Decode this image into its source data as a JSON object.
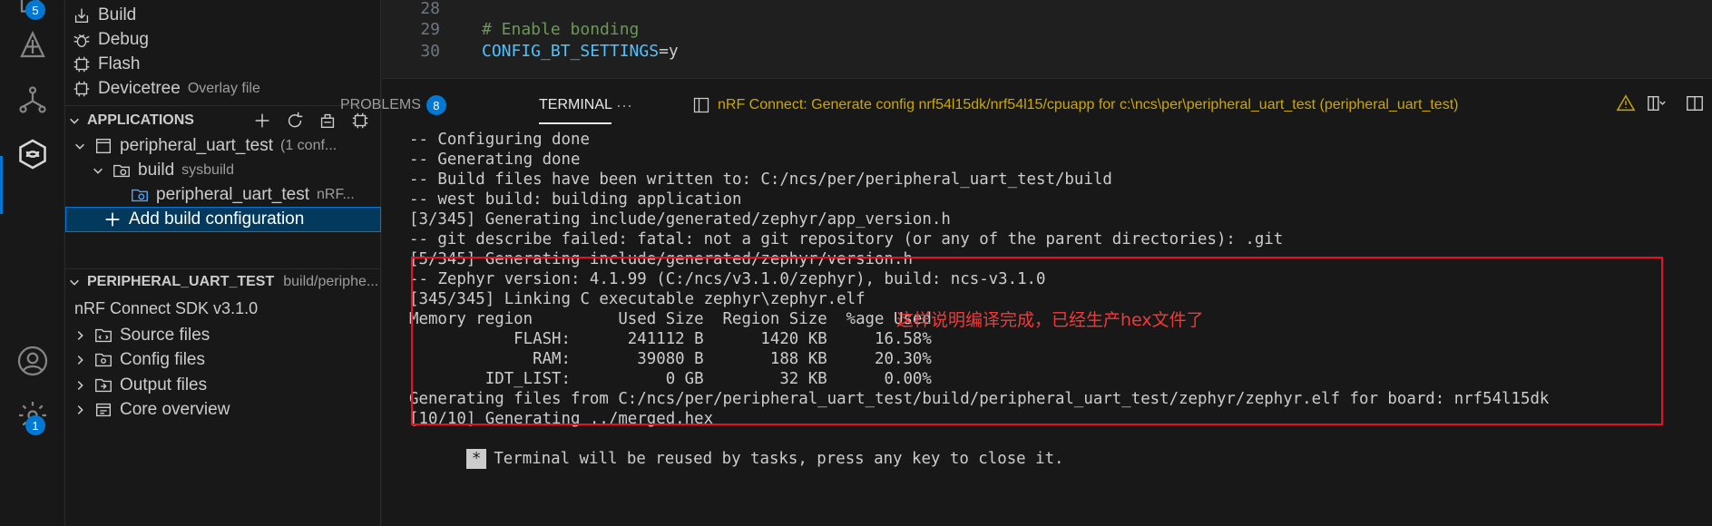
{
  "activity_bar": {
    "explorer_badge": "5",
    "settings_badge": "1"
  },
  "sidebar": {
    "actions": [
      {
        "label": "Build",
        "icon": "build-icon"
      },
      {
        "label": "Debug",
        "icon": "debug-icon"
      },
      {
        "label": "Flash",
        "icon": "flash-icon"
      },
      {
        "label": "Devicetree",
        "desc": "Overlay file",
        "icon": "devicetree-icon"
      }
    ],
    "applications_header": "APPLICATIONS",
    "app": {
      "label": "peripheral_uart_test",
      "desc": "(1 conf..."
    },
    "build": {
      "label": "build",
      "desc": "sysbuild"
    },
    "build_image": {
      "label": "peripheral_uart_test",
      "desc": "nRF..."
    },
    "add_build_configuration": "Add build configuration",
    "details_header": "PERIPHERAL_UART_TEST",
    "details_desc": "build/periphe...",
    "sdk_version": "nRF Connect SDK v3.1.0",
    "details_items": [
      {
        "label": "Source files",
        "icon": "source-files-icon"
      },
      {
        "label": "Config files",
        "icon": "config-files-icon"
      },
      {
        "label": "Output files",
        "icon": "output-files-icon"
      },
      {
        "label": "Core overview",
        "icon": "core-overview-icon"
      }
    ]
  },
  "editor": {
    "lines": [
      {
        "number": "28",
        "text": ""
      },
      {
        "number": "29",
        "comment": "# Enable bonding"
      },
      {
        "number": "30",
        "key": "CONFIG_BT_SETTINGS",
        "value": "=y"
      }
    ]
  },
  "panel": {
    "tabs": [
      {
        "label": "PROBLEMS",
        "badge": "8"
      },
      {
        "label": "TERMINAL"
      }
    ],
    "more": "···",
    "task_title": "nRF Connect: Generate config nrf54l15dk/nrf54l15/cpuapp for c:\\ncs\\per\\peripheral_uart_test (peripheral_uart_test)",
    "terminal_lines": [
      "-- Configuring done",
      "-- Generating done",
      "-- Build files have been written to: C:/ncs/per/peripheral_uart_test/build",
      "-- west build: building application",
      "[3/345] Generating include/generated/zephyr/app_version.h",
      "-- git describe failed: fatal: not a git repository (or any of the parent directories): .git",
      "[5/345] Generating include/generated/zephyr/version.h",
      "-- Zephyr version: 4.1.99 (C:/ncs/v3.1.0/zephyr), build: ncs-v3.1.0",
      "[345/345] Linking C executable zephyr\\zephyr.elf",
      "Memory region         Used Size  Region Size  %age Used",
      "           FLASH:      241112 B      1420 KB     16.58%",
      "             RAM:       39080 B       188 KB     20.30%",
      "        IDT_LIST:          0 GB        32 KB      0.00%",
      "Generating files from C:/ncs/per/peripheral_uart_test/build/peripheral_uart_test/zephyr/zephyr.elf for board: nrf54l15dk",
      "[10/10] Generating ../merged.hex"
    ],
    "reuse_marker": "*",
    "reuse_message": "Terminal will be reused by tasks, press any key to close it."
  },
  "annotation": "这样说明编译完成，已经生产hex文件了",
  "colors": {
    "accent": "#0078d4",
    "warning": "#cca700",
    "highlight": "#e81123"
  }
}
